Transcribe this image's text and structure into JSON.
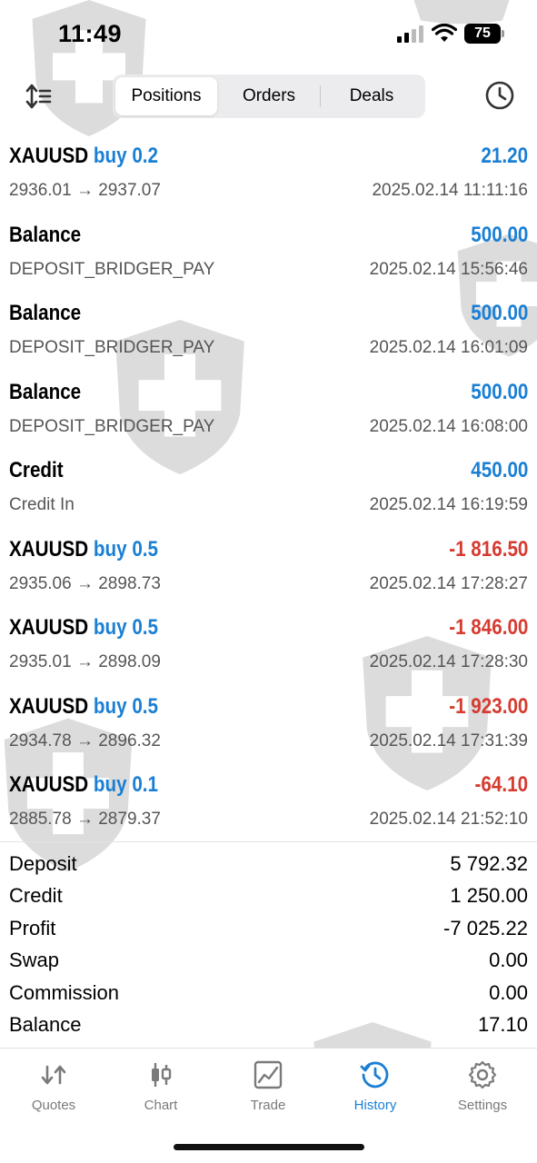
{
  "status_bar": {
    "time": "11:49",
    "battery": "75"
  },
  "segments": [
    "Positions",
    "Orders",
    "Deals"
  ],
  "deals": [
    {
      "symbol": "XAUUSD",
      "side": "buy 0.2",
      "profit": "21.20",
      "profit_sign": "pos",
      "detail": "2936.01 → 2937.07",
      "time": "2025.02.14 11:11:16"
    },
    {
      "symbol": "Balance",
      "side": "",
      "profit": "500.00",
      "profit_sign": "pos",
      "detail": "DEPOSIT_BRIDGER_PAY",
      "time": "2025.02.14 15:56:46"
    },
    {
      "symbol": "Balance",
      "side": "",
      "profit": "500.00",
      "profit_sign": "pos",
      "detail": "DEPOSIT_BRIDGER_PAY",
      "time": "2025.02.14 16:01:09"
    },
    {
      "symbol": "Balance",
      "side": "",
      "profit": "500.00",
      "profit_sign": "pos",
      "detail": "DEPOSIT_BRIDGER_PAY",
      "time": "2025.02.14 16:08:00"
    },
    {
      "symbol": "Credit",
      "side": "",
      "profit": "450.00",
      "profit_sign": "pos",
      "detail": "Credit In",
      "time": "2025.02.14 16:19:59"
    },
    {
      "symbol": "XAUUSD",
      "side": "buy 0.5",
      "profit": "-1 816.50",
      "profit_sign": "neg",
      "detail": "2935.06 → 2898.73",
      "time": "2025.02.14 17:28:27"
    },
    {
      "symbol": "XAUUSD",
      "side": "buy 0.5",
      "profit": "-1 846.00",
      "profit_sign": "neg",
      "detail": "2935.01 → 2898.09",
      "time": "2025.02.14 17:28:30"
    },
    {
      "symbol": "XAUUSD",
      "side": "buy 0.5",
      "profit": "-1 923.00",
      "profit_sign": "neg",
      "detail": "2934.78 → 2896.32",
      "time": "2025.02.14 17:31:39"
    },
    {
      "symbol": "XAUUSD",
      "side": "buy 0.1",
      "profit": "-64.10",
      "profit_sign": "neg",
      "detail": "2885.78 → 2879.37",
      "time": "2025.02.14 21:52:10"
    }
  ],
  "summary": [
    {
      "label": "Deposit",
      "value": "5 792.32"
    },
    {
      "label": "Credit",
      "value": "1 250.00"
    },
    {
      "label": "Profit",
      "value": "-7 025.22"
    },
    {
      "label": "Swap",
      "value": "0.00"
    },
    {
      "label": "Commission",
      "value": "0.00"
    },
    {
      "label": "Balance",
      "value": "17.10"
    }
  ],
  "tabs": [
    {
      "label": "Quotes",
      "icon": "quotes-icon"
    },
    {
      "label": "Chart",
      "icon": "chart-icon"
    },
    {
      "label": "Trade",
      "icon": "trade-icon"
    },
    {
      "label": "History",
      "icon": "history-icon"
    },
    {
      "label": "Settings",
      "icon": "settings-icon"
    }
  ],
  "active_tab": "History",
  "colors": {
    "accent": "#1a7fd4",
    "negative": "#d63b30",
    "watermark": "#d9d9d9"
  }
}
